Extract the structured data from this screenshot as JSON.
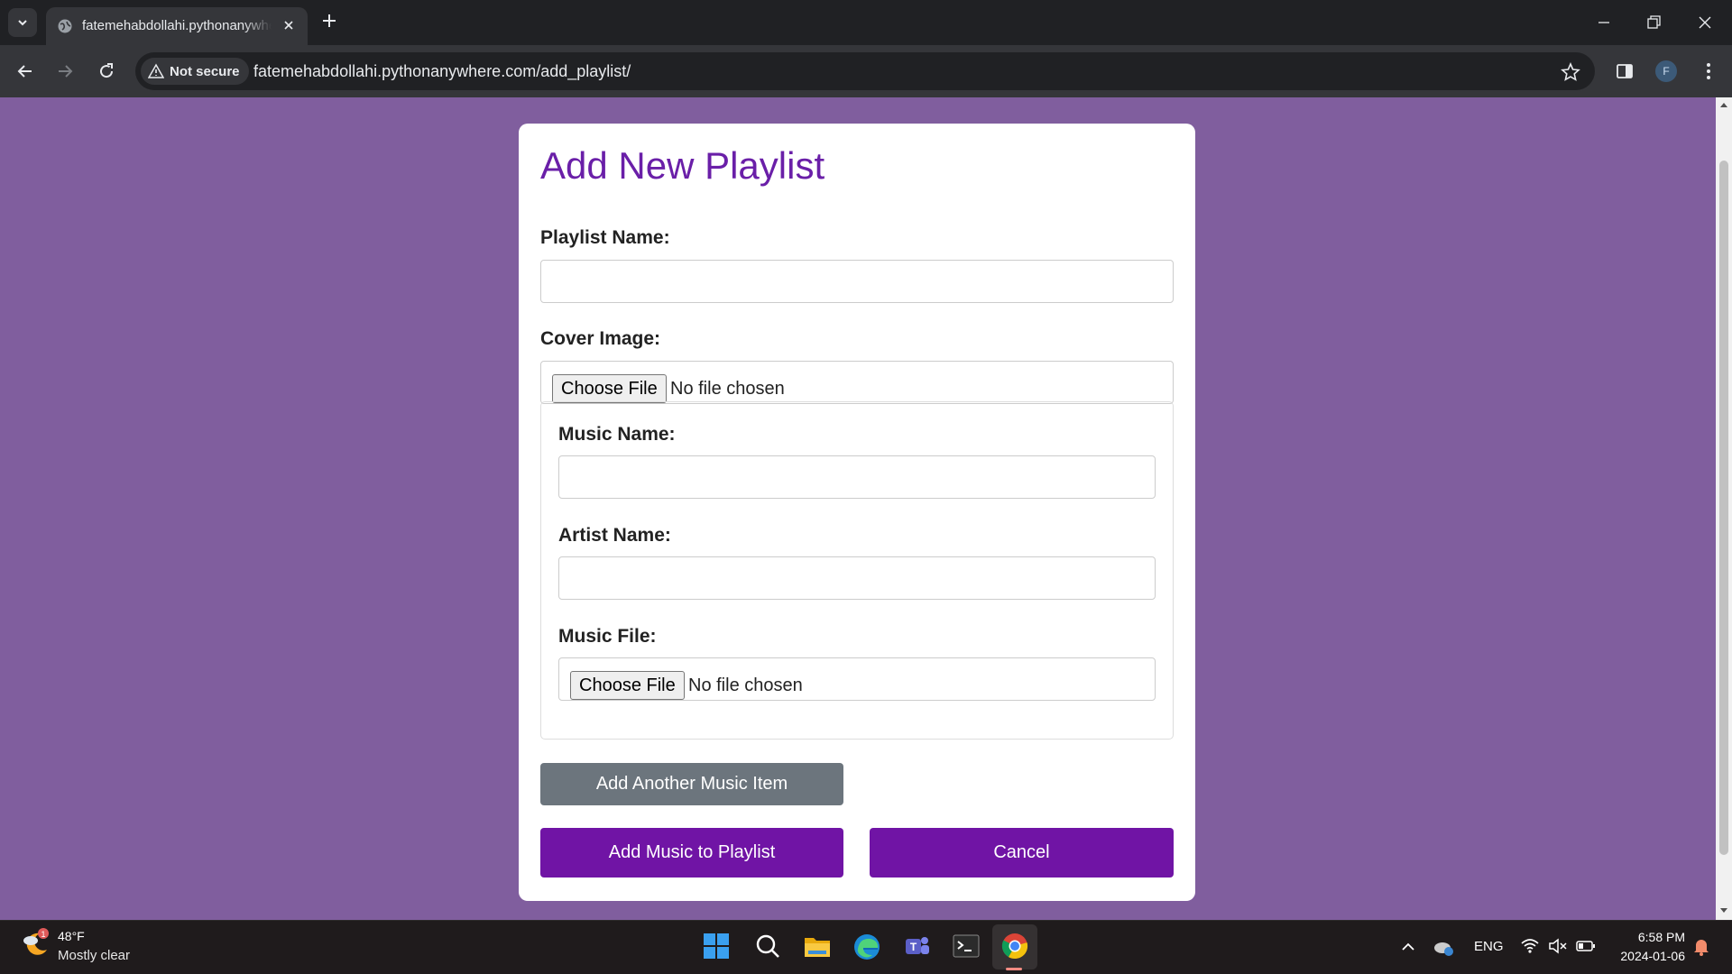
{
  "browser": {
    "tab_title": "fatemehabdollahi.pythonanywhere.com/add_playlist/",
    "security_label": "Not secure",
    "url": "fatemehabdollahi.pythonanywhere.com/add_playlist/",
    "profile_initial": "F"
  },
  "form": {
    "title": "Add New Playlist",
    "playlist_name_label": "Playlist Name:",
    "playlist_name_value": "",
    "cover_image_label": "Cover Image:",
    "choose_file_label": "Choose File",
    "no_file_text": "No file chosen",
    "music_item": {
      "music_name_label": "Music Name:",
      "music_name_value": "",
      "artist_name_label": "Artist Name:",
      "artist_name_value": "",
      "music_file_label": "Music File:",
      "choose_file_label": "Choose File",
      "no_file_text": "No file chosen"
    },
    "add_another_label": "Add Another Music Item",
    "submit_label": "Add Music to Playlist",
    "cancel_label": "Cancel"
  },
  "taskbar": {
    "weather_temp": "48°F",
    "weather_desc": "Mostly clear",
    "weather_badge": "1",
    "language": "ENG",
    "time": "6:58 PM",
    "date": "2024-01-06"
  },
  "colors": {
    "page_background": "#805e9e",
    "title_color": "#6a1fa8",
    "primary_button": "#7014a5",
    "secondary_button": "#6c757d"
  }
}
